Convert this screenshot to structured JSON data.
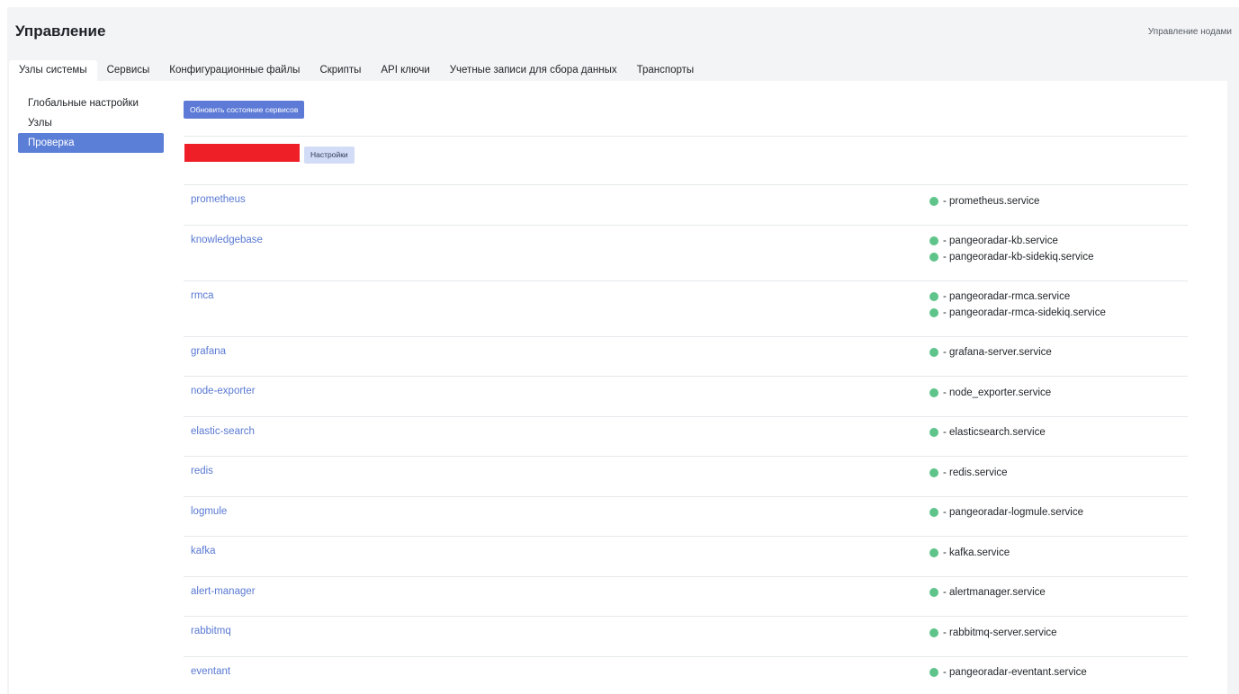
{
  "header": {
    "title": "Управление",
    "nodes_link": "Управление нодами"
  },
  "tabs": [
    {
      "label": "Узлы системы",
      "active": true
    },
    {
      "label": "Сервисы"
    },
    {
      "label": "Конфигурационные файлы"
    },
    {
      "label": "Скрипты"
    },
    {
      "label": "API ключи"
    },
    {
      "label": "Учетные записи для сбора данных"
    },
    {
      "label": "Транспорты"
    }
  ],
  "sidebar": {
    "items": [
      {
        "label": "Глобальные настройки"
      },
      {
        "label": "Узлы"
      },
      {
        "label": "Проверка",
        "active": true
      }
    ]
  },
  "toolbar": {
    "refresh_label": "Обновить состояние сервисов",
    "settings_label": "Настройки"
  },
  "status_color": "#5ec48a",
  "accent_color": "#5b7fd6",
  "services": [
    {
      "name": "prometheus",
      "units": [
        "- prometheus.service"
      ]
    },
    {
      "name": "knowledgebase",
      "units": [
        "- pangeoradar-kb.service",
        "- pangeoradar-kb-sidekiq.service"
      ]
    },
    {
      "name": "rmca",
      "units": [
        "- pangeoradar-rmca.service",
        "- pangeoradar-rmca-sidekiq.service"
      ]
    },
    {
      "name": "grafana",
      "units": [
        "- grafana-server.service"
      ]
    },
    {
      "name": "node-exporter",
      "units": [
        "- node_exporter.service"
      ]
    },
    {
      "name": "elastic-search",
      "units": [
        "- elasticsearch.service"
      ]
    },
    {
      "name": "redis",
      "units": [
        "- redis.service"
      ]
    },
    {
      "name": "logmule",
      "units": [
        "- pangeoradar-logmule.service"
      ]
    },
    {
      "name": "kafka",
      "units": [
        "- kafka.service"
      ]
    },
    {
      "name": "alert-manager",
      "units": [
        "- alertmanager.service"
      ]
    },
    {
      "name": "rabbitmq",
      "units": [
        "- rabbitmq-server.service"
      ]
    },
    {
      "name": "eventant",
      "units": [
        "- pangeoradar-eventant.service"
      ]
    }
  ]
}
